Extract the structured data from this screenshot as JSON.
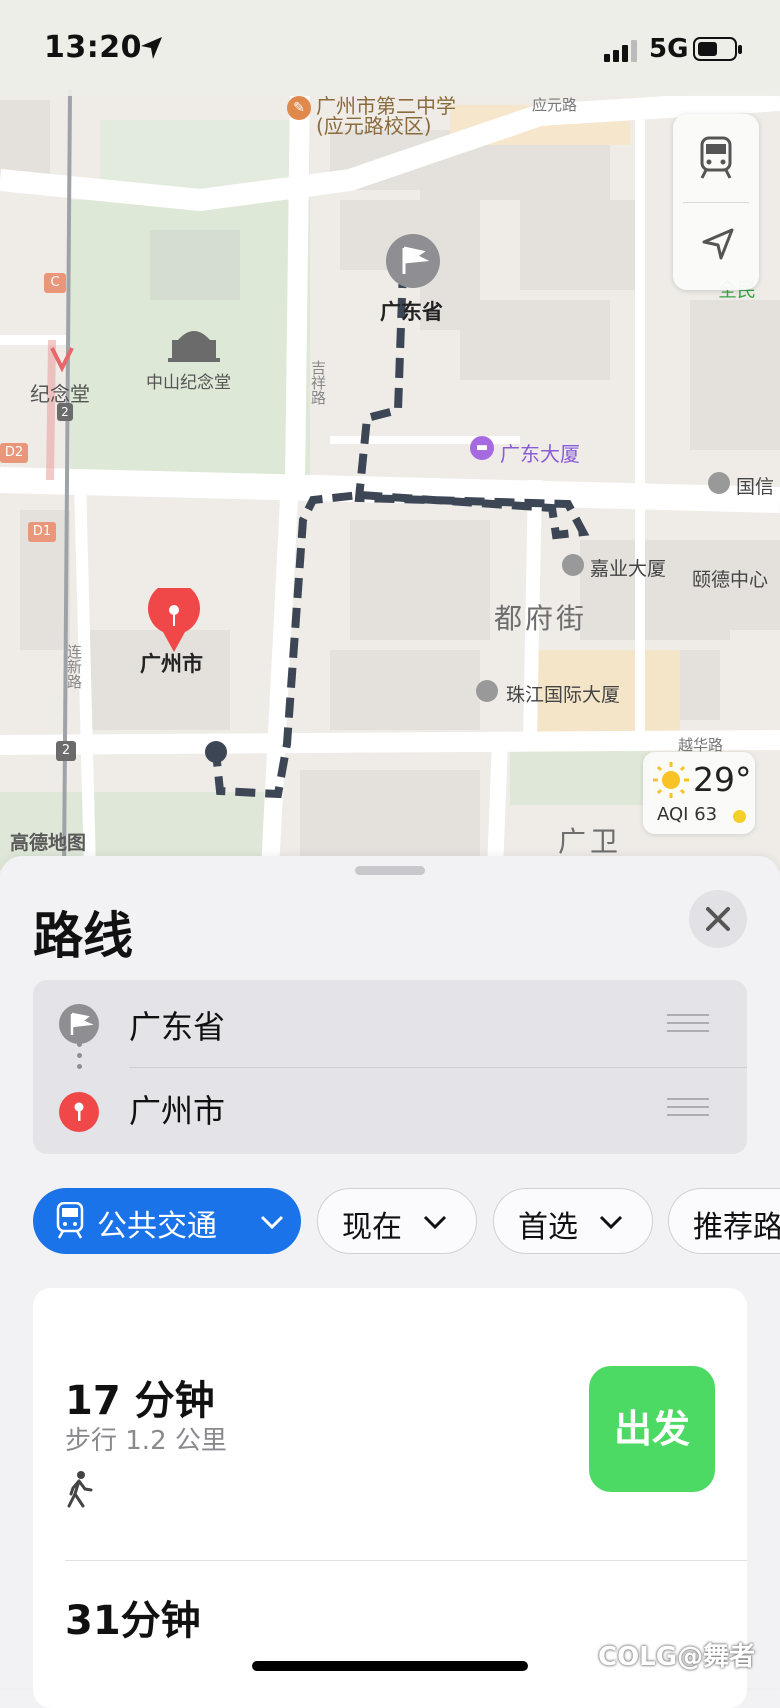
{
  "status_bar": {
    "time": "13:20",
    "network": "5G",
    "icons": [
      "location-arrow-icon",
      "signal-bars-icon",
      "battery-icon"
    ]
  },
  "map": {
    "labels": {
      "school": "广州市第二中学",
      "school_campus": "(应元路校区)",
      "yingyuan_road": "应元路",
      "memorial_hall": "中山纪念堂",
      "memorial_station": "纪念堂",
      "jixiang_road": "吉祥路",
      "lianxin_road": "连新路",
      "guangdong_hotel": "广东大厦",
      "jiaye_building": "嘉业大厦",
      "yide_center": "颐德中心",
      "guoxin": "国信",
      "dufu_street": "都府街",
      "pearl_river_building": "珠江国际大厦",
      "yuehua_road": "越华路",
      "guangwei": "广卫",
      "quan": "全民",
      "exit_c": "C",
      "exit_d2": "D2",
      "exit_d1": "D1",
      "line2_a": "2",
      "line2_b": "2"
    },
    "pins": {
      "start_label": "广东省",
      "end_label": "广州市"
    },
    "provider": "高德地图",
    "weather": {
      "temperature": "29°",
      "aqi": "AQI 63",
      "icon": "sun-icon",
      "aqi_color": "#f4cf2a"
    },
    "controls": [
      "transit-mode-icon",
      "locate-me-icon"
    ],
    "route_color": "#3d4654"
  },
  "sheet": {
    "title": "路线",
    "waypoints": [
      {
        "label": "广东省",
        "icon": "flag-icon",
        "color": "#8e8e93"
      },
      {
        "label": "广州市",
        "icon": "pin-icon",
        "color": "#f04848"
      }
    ],
    "chips": [
      {
        "label": "公共交通",
        "icon": "transit-icon",
        "active": true
      },
      {
        "label": "现在",
        "active": false
      },
      {
        "label": "首选",
        "active": false
      },
      {
        "label": "推荐路",
        "active": false
      }
    ],
    "routes": [
      {
        "duration": "17 分钟",
        "detail": "步行 1.2 公里",
        "mode_icon": "walking-icon",
        "go_label": "出发"
      },
      {
        "duration": "31分钟"
      }
    ]
  },
  "watermark": "COLG@舞者",
  "accent_color": "#1a73e8",
  "go_color": "#4cd964"
}
